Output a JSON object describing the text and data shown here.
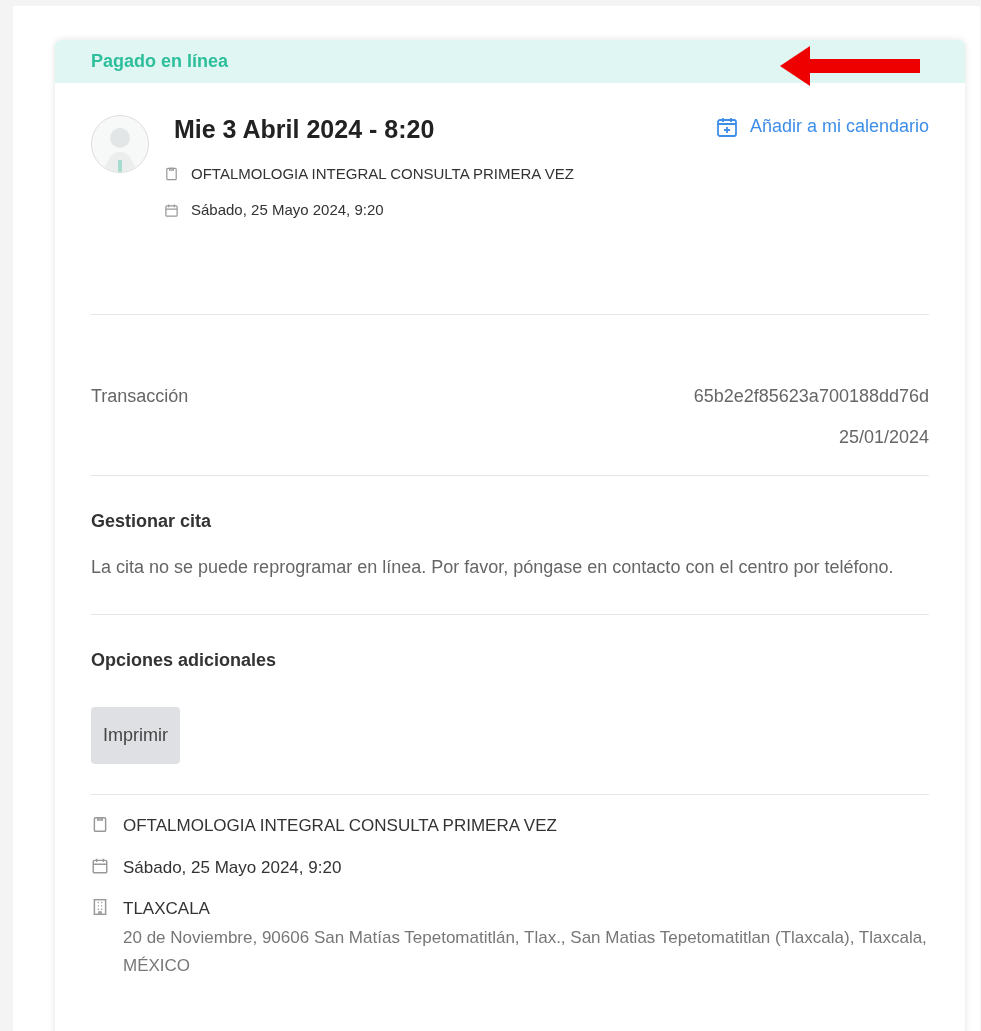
{
  "status_banner": {
    "label": "Pagado en línea"
  },
  "appointment": {
    "title": "Mie 3 Abril 2024 - 8:20",
    "calendar_link": "Añadir a mi calendario",
    "details": [
      {
        "kind": "service",
        "text": "OFTALMOLOGIA INTEGRAL CONSULTA PRIMERA VEZ"
      },
      {
        "kind": "date",
        "text": "Sábado, 25 Mayo 2024, 9:20"
      }
    ]
  },
  "transaction": {
    "label": "Transacción",
    "id": "65b2e2f85623a700188dd76d",
    "date": "25/01/2024"
  },
  "manage": {
    "heading": "Gestionar cita",
    "message": "La cita no se puede reprogramar en línea. Por favor, póngase en contacto con el centro por teléfono."
  },
  "options": {
    "heading": "Opciones adicionales",
    "buttons": [
      "Imprimir"
    ]
  },
  "summary": [
    {
      "kind": "service",
      "text": "OFTALMOLOGIA INTEGRAL CONSULTA PRIMERA VEZ"
    },
    {
      "kind": "date",
      "text": "Sábado, 25 Mayo 2024, 9:20"
    },
    {
      "kind": "place",
      "text": "TLAXCALA",
      "address": "20 de Noviembre, 90606 San Matías Tepetomatitlán, Tlax., San Matias Tepetomatitlan (Tlaxcala), Tlaxcala, MÉXICO"
    }
  ]
}
